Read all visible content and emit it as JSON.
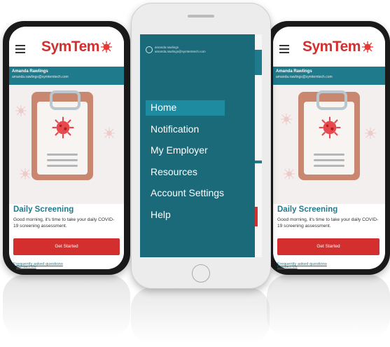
{
  "app": {
    "logo_text": "SymTem",
    "brand_color": "#d32f2f",
    "accent_color": "#1f7a8c"
  },
  "left_phone": {
    "user_name": "Amanda Rawlings",
    "user_email": "amanda.rawlings@symtemtech.com",
    "card_title": "Daily Screening",
    "card_body": "Good morning, it's time to take your daily COVID-19 screening assessment.",
    "cta_label": "Get Started",
    "link_faq": "Frequently asked questions",
    "link_contact": "Contact Us"
  },
  "right_phone": {
    "user_name": "Amanda Rawlings",
    "user_email": "amanda.rawlings@symtemtech.com",
    "card_title": "Daily Screening",
    "card_body": "Good morning, it's time to take your daily COVID-19 screening assessment.",
    "cta_label": "Get Started",
    "link_faq": "Frequently asked questions",
    "link_contact": "Contact Us"
  },
  "center_phone": {
    "menu_header": "amanda rawlings\namanda.rawlings@symtemtech.com",
    "menu_items": [
      "Home",
      "Notification",
      "My Employer",
      "Resources",
      "Account Settings",
      "Help"
    ],
    "partial_text": "ily"
  }
}
